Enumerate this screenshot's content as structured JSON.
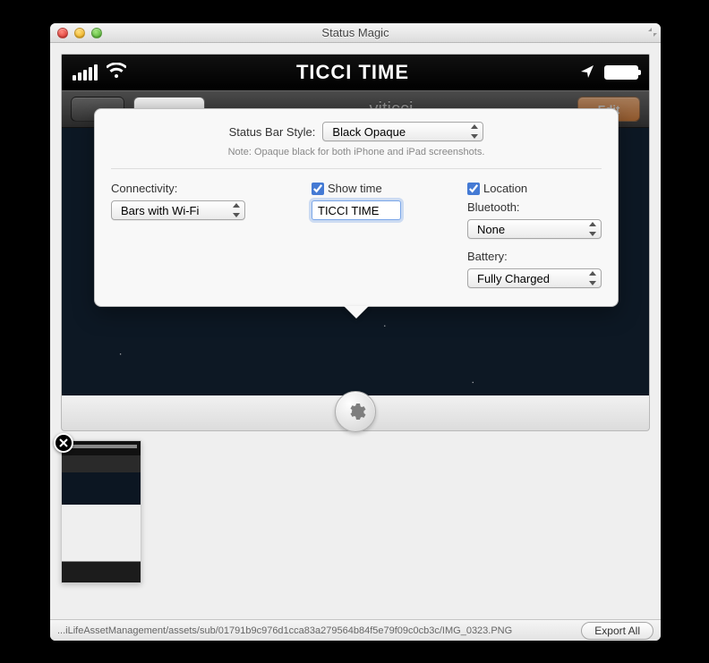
{
  "window": {
    "title": "Status Magic"
  },
  "statusbar": {
    "time_text": "TICCI TIME"
  },
  "device": {
    "center_label": "viticci",
    "edit_label": "Edit"
  },
  "popover": {
    "style_label": "Status Bar Style:",
    "style_value": "Black Opaque",
    "note": "Note: Opaque black for both iPhone and iPad screenshots.",
    "connectivity_label": "Connectivity:",
    "connectivity_value": "Bars with Wi-Fi",
    "show_time_label": "Show time",
    "show_time_checked": true,
    "time_value": "TICCI TIME",
    "location_label": "Location",
    "location_checked": true,
    "bluetooth_label": "Bluetooth:",
    "bluetooth_value": "None",
    "battery_label": "Battery:",
    "battery_value": "Fully Charged"
  },
  "footer": {
    "path": "...iLifeAssetManagement/assets/sub/01791b9c976d1cca83a279564b84f5e79f09c0cb3c/IMG_0323.PNG",
    "export_label": "Export All"
  }
}
